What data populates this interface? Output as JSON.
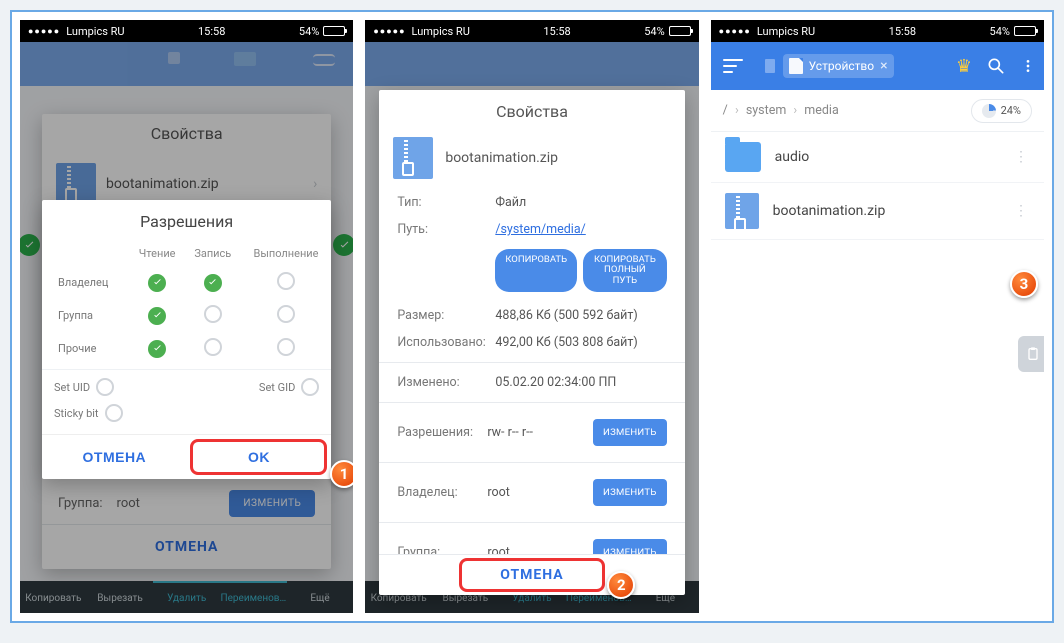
{
  "status": {
    "carrier": "Lumpics RU",
    "time": "15:58",
    "battery": "54%"
  },
  "file": {
    "name": "bootanimation.zip"
  },
  "properties_title": "Свойства",
  "permissions": {
    "title": "Разрешения",
    "cols": {
      "read": "Чтение",
      "write": "Запись",
      "exec": "Выполнение"
    },
    "rows": {
      "owner": "Владелец",
      "group": "Группа",
      "other": "Прочие"
    },
    "special": {
      "setuid": "Set UID",
      "setgid": "Set GID",
      "sticky": "Sticky bit"
    },
    "cancel": "ОТМЕНА",
    "ok": "OK"
  },
  "phone1": {
    "group_label": "Группа:",
    "group_value": "root",
    "change": "ИЗМЕНИТЬ",
    "cancel": "ОТМЕНА",
    "bottom": {
      "copy": "Копировать",
      "cut": "Вырезать",
      "delete": "Удалить",
      "rename": "Переименов…",
      "more": "Ещё"
    }
  },
  "phone2": {
    "type_k": "Тип:",
    "type_v": "Файл",
    "path_k": "Путь:",
    "path_v": "/system/media/",
    "copy": "КОПИРОВАТЬ",
    "copy_full": "КОПИРОВАТЬ ПОЛНЫЙ ПУТЬ",
    "size_k": "Размер:",
    "size_v": "488,86 Кб (500 592 байт)",
    "used_k": "Использовано:",
    "used_v": "492,00 Кб (503 808 байт)",
    "mod_k": "Изменено:",
    "mod_v": "05.02.20 02:34:00 ПП",
    "perm_k": "Разрешения:",
    "perm_v": "rw- r-- r--",
    "owner_k": "Владелец:",
    "owner_v": "root",
    "group_k": "Группа:",
    "group_v": "root",
    "change": "ИЗМЕНИТЬ",
    "cancel": "ОТМЕНА",
    "bottom": {
      "copy": "Копировать",
      "cut": "Вырезать",
      "delete": "Удалить",
      "rename": "Переименов…",
      "more": "Ещё"
    }
  },
  "phone3": {
    "chip": "Устройство",
    "crumb": {
      "root": "/",
      "a": "system",
      "b": "media"
    },
    "usage": "24%",
    "items": {
      "audio": "audio",
      "zip": "bootanimation.zip"
    }
  },
  "badges": {
    "b1": "1",
    "b2": "2",
    "b3": "3"
  }
}
